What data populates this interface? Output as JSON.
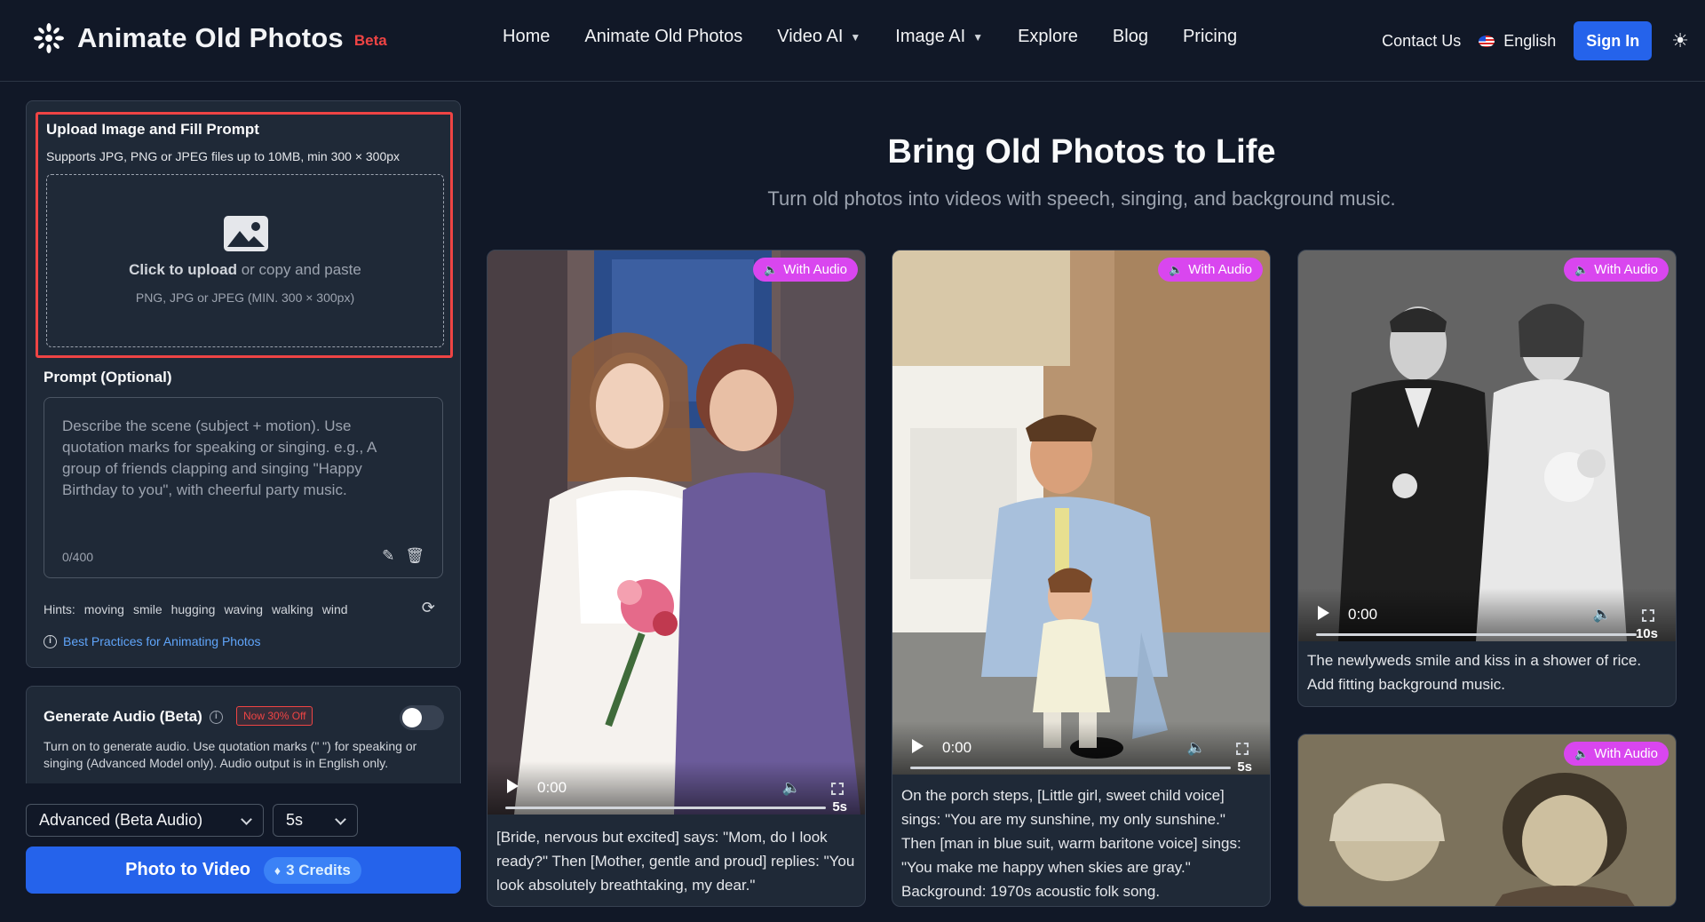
{
  "header": {
    "logo_text": "Animate Old Photos",
    "logo_badge": "Beta",
    "nav": [
      "Home",
      "Animate Old Photos",
      "Video AI",
      "Image AI",
      "Explore",
      "Blog",
      "Pricing"
    ],
    "contact": "Contact Us",
    "language": "English",
    "signin": "Sign In"
  },
  "upload": {
    "title": "Upload Image and Fill Prompt",
    "subtitle": "Supports JPG, PNG or JPEG files up to 10MB, min 300 × 300px",
    "click_text": "Click to upload",
    "click_rest": " or copy and paste",
    "formats": "PNG, JPG or JPEG (MIN. 300 × 300px)"
  },
  "prompt": {
    "label": "Prompt (Optional)",
    "placeholder": "Describe the scene (subject + motion). Use quotation marks for speaking or singing. e.g., A group of friends clapping and singing \"Happy Birthday to you\", with cheerful party music.",
    "count": "0/400",
    "hints_label": "Hints:",
    "hints": [
      "moving",
      "smile",
      "hugging",
      "waving",
      "walking",
      "wind"
    ],
    "best_practices": "Best Practices for Animating Photos"
  },
  "audio": {
    "title": "Generate Audio (Beta)",
    "badge": "Now 30% Off",
    "enabled": false,
    "description": "Turn on to generate audio. Use quotation marks (\" \") for speaking or singing (Advanced Model only). Audio output is in English only."
  },
  "controls": {
    "model": "Advanced (Beta Audio)",
    "duration": "5s",
    "cta_label": "Photo to Video",
    "cta_credits": "3 Credits"
  },
  "main": {
    "title": "Bring Old Photos to Life",
    "subtitle": "Turn old photos into videos with speech, singing, and background music."
  },
  "cards": [
    {
      "badge": "With Audio",
      "time": "0:00",
      "duration": "5s",
      "caption": "[Bride, nervous but excited] says: \"Mom, do I look ready?\" Then [Mother, gentle and proud] replies: \"You look absolutely breathtaking, my dear.\""
    },
    {
      "badge": "With Audio",
      "time": "0:00",
      "duration": "5s",
      "caption": "On the porch steps, [Little girl, sweet child voice] sings: \"You are my sunshine, my only sunshine.\" Then [man in blue suit, warm baritone voice] sings: \"You make me happy when skies are gray.\" Background: 1970s acoustic folk song."
    },
    {
      "badge": "With Audio",
      "time": "0:00",
      "duration": "10s",
      "caption": "The newlyweds smile and kiss in a shower of rice. Add fitting background music."
    },
    {
      "badge": "With Audio"
    }
  ],
  "colors": {
    "bg": "#111827",
    "panel": "#1f2937",
    "accent": "#2563eb",
    "highlight": "#ef4444",
    "audio_badge": "#d946ef"
  }
}
